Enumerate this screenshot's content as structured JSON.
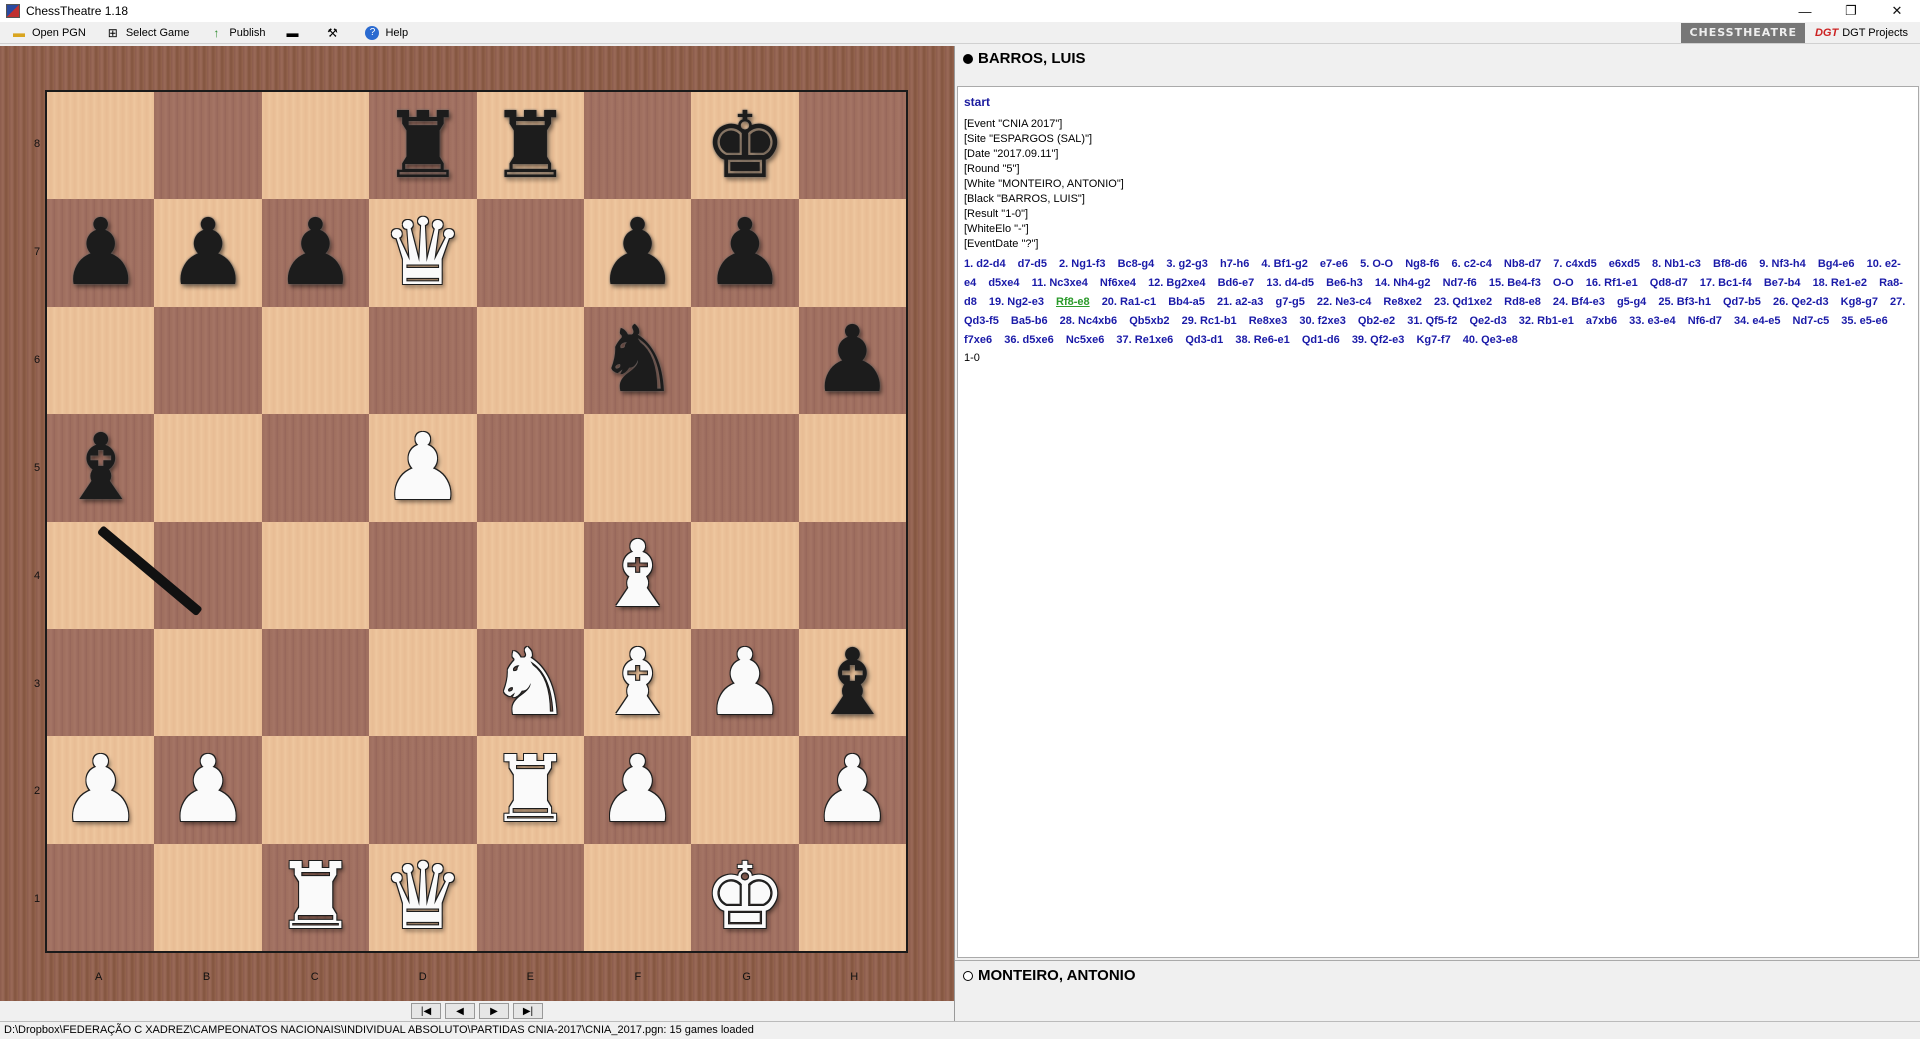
{
  "window": {
    "title": "ChessTheatre 1.18"
  },
  "toolbar": {
    "open_pgn": "Open PGN",
    "select_game": "Select Game",
    "publish": "Publish",
    "help": "Help",
    "brand_chesstheatre": "CHESSTHEATRE",
    "brand_dgt": "DGT Projects"
  },
  "players": {
    "black": "BARROS, LUIS",
    "white": "MONTEIRO, ANTONIO"
  },
  "board": {
    "ranks": [
      "8",
      "7",
      "6",
      "5",
      "4",
      "3",
      "2",
      "1"
    ],
    "files": [
      "A",
      "B",
      "C",
      "D",
      "E",
      "F",
      "G",
      "H"
    ],
    "squares": [
      [
        "",
        "",
        "",
        "r",
        "r",
        "",
        "k",
        ""
      ],
      [
        "p",
        "p",
        "p",
        "Q",
        "",
        "p",
        "p",
        ""
      ],
      [
        "",
        "",
        "",
        "",
        "",
        "n",
        "",
        "p"
      ],
      [
        "b",
        "",
        "",
        "P",
        "",
        "",
        "",
        ""
      ],
      [
        "",
        "",
        "",
        "",
        "",
        "B",
        "",
        ""
      ],
      [
        "",
        "",
        "",
        "",
        "N",
        "B",
        "P",
        "b"
      ],
      [
        "P",
        "P",
        "",
        "",
        "R",
        "P",
        "",
        "P"
      ],
      [
        "",
        "",
        "R",
        "Q",
        "",
        "",
        "K",
        ""
      ]
    ]
  },
  "game": {
    "start_label": "start",
    "tags": [
      "[Event \"CNIA 2017\"]",
      "[Site \"ESPARGOS (SAL)\"]",
      "[Date \"2017.09.11\"]",
      "[Round \"5\"]",
      "[White \"MONTEIRO, ANTONIO\"]",
      "[Black \"BARROS, LUIS\"]",
      "[Result \"1-0\"]",
      "[WhiteElo \"-\"]",
      "[EventDate \"?\"]"
    ],
    "moves": [
      "1. d2-d4",
      "d7-d5",
      "2. Ng1-f3",
      "Bc8-g4",
      "3. g2-g3",
      "h7-h6",
      "4. Bf1-g2",
      "e7-e6",
      "5. O-O",
      "Ng8-f6",
      "6. c2-c4",
      "Nb8-d7",
      "7. c4xd5",
      "e6xd5",
      "8. Nb1-c3",
      "Bf8-d6",
      "9. Nf3-h4",
      "Bg4-e6",
      "10. e2-e4",
      "d5xe4",
      "11. Nc3xe4",
      "Nf6xe4",
      "12. Bg2xe4",
      "Bd6-e7",
      "13. d4-d5",
      "Be6-h3",
      "14. Nh4-g2",
      "Nd7-f6",
      "15. Be4-f3",
      "O-O",
      "16. Rf1-e1",
      "Qd8-d7",
      "17. Bc1-f4",
      "Be7-b4",
      "18. Re1-e2",
      "Ra8-d8",
      "19. Ng2-e3",
      "Rf8-e8",
      "20. Ra1-c1",
      "Bb4-a5",
      "21. a2-a3",
      "g7-g5",
      "22. Ne3-c4",
      "Re8xe2",
      "23. Qd1xe2",
      "Rd8-e8",
      "24. Bf4-e3",
      "g5-g4",
      "25. Bf3-h1",
      "Qd7-b5",
      "26. Qe2-d3",
      "Kg8-g7",
      "27. Qd3-f5",
      "Ba5-b6",
      "28. Nc4xb6",
      "Qb5xb2",
      "29. Rc1-b1",
      "Re8xe3",
      "30. f2xe3",
      "Qb2-e2",
      "31. Qf5-f2",
      "Qe2-d3",
      "32. Rb1-e1",
      "a7xb6",
      "33. e3-e4",
      "Nf6-d7",
      "34. e4-e5",
      "Nd7-c5",
      "35. e5-e6",
      "f7xe6",
      "36. d5xe6",
      "Nc5xe6",
      "37. Re1xe6",
      "Qd3-d1",
      "38. Re6-e1",
      "Qd1-d6",
      "39. Qf2-e3",
      "Kg7-f7",
      "40. Qe3-e8"
    ],
    "current_move_index": 37,
    "result": "1-0"
  },
  "status": "D:\\Dropbox\\FEDERAÇÃO C XADREZ\\CAMPEONATOS NACIONAIS\\INDIVIDUAL ABSOLUTO\\PARTIDAS CNIA-2017\\CNIA_2017.pgn: 15 games loaded"
}
